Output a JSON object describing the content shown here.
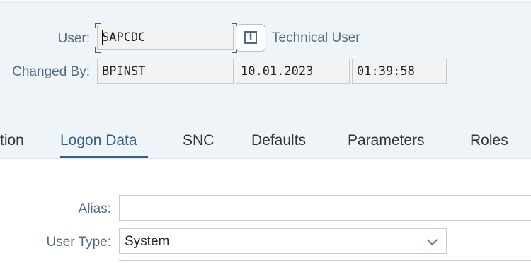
{
  "header": {
    "user_label": "User:",
    "user_value": "SAPCDC",
    "user_description": "Technical User",
    "changed_by_label": "Changed By:",
    "changed_by_value": "BPINST",
    "changed_date": "10.01.2023",
    "changed_time": "01:39:58"
  },
  "tabs": [
    {
      "label": "tion",
      "active": false
    },
    {
      "label": "Logon Data",
      "active": true
    },
    {
      "label": "SNC",
      "active": false
    },
    {
      "label": "Defaults",
      "active": false
    },
    {
      "label": "Parameters",
      "active": false
    },
    {
      "label": "Roles",
      "active": false
    }
  ],
  "form": {
    "alias_label": "Alias:",
    "alias_value": "",
    "user_type_label": "User Type:",
    "user_type_value": "System"
  },
  "colors": {
    "header_bg": "#eff4f9",
    "accent": "#346187",
    "label": "#556b82"
  },
  "icons": {
    "info": "info-icon",
    "dropdown": "chevron-down-icon"
  }
}
